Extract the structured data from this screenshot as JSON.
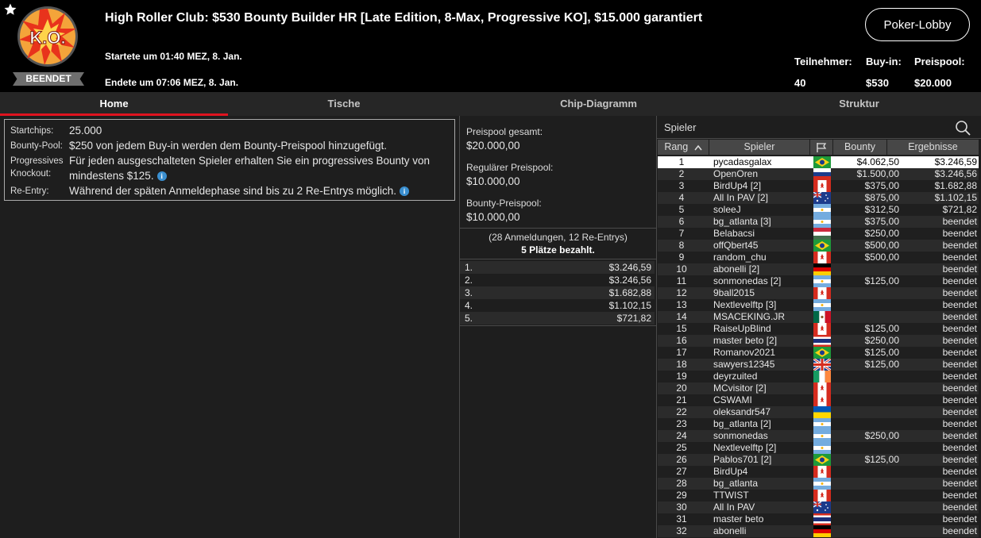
{
  "header": {
    "title": "High Roller Club: $530 Bounty Builder HR [Late Edition, 8-Max, Progressive KO], $15.000 garantiert",
    "logo_text": "K.O.",
    "status": "BEENDET",
    "started": "Startete um 01:40 MEZ, 8. Jan.",
    "ended": "Endete um 07:06 MEZ, 8. Jan.",
    "lobby_button": "Poker-Lobby",
    "stats": [
      {
        "label": "Teilnehmer:",
        "value": "40"
      },
      {
        "label": "Buy-in:",
        "value": "$530"
      },
      {
        "label": "Preispool:",
        "value": "$20.000"
      }
    ]
  },
  "tabs": [
    {
      "label": "Home",
      "active": true
    },
    {
      "label": "Tische",
      "active": false
    },
    {
      "label": "Chip-Diagramm",
      "active": false
    },
    {
      "label": "Struktur",
      "active": false
    }
  ],
  "info": {
    "startchips_label": "Startchips:",
    "startchips_value": "25.000",
    "bountypool_label": "Bounty-Pool:",
    "bountypool_value": "$250 von jedem Buy-in werden dem Bounty-Preispool hinzugefügt.",
    "pko_label_1": "Progressives",
    "pko_label_2": "Knockout:",
    "pko_value_1": "Für jeden ausgeschalteten Spieler erhalten Sie ein progressives Bounty von",
    "pko_value_2": "mindestens $125.",
    "reentry_label": "Re-Entry:",
    "reentry_value": "Während der späten Anmeldephase sind bis zu 2 Re-Entrys möglich.",
    "info_icon_glyph": "i"
  },
  "prizepool": {
    "total_label": "Preispool gesamt:",
    "total_value": "$20.000,00",
    "regular_label": "Regulärer Preispool:",
    "regular_value": "$10.000,00",
    "bounty_label": "Bounty-Preispool:",
    "bounty_value": "$10.000,00",
    "entries_text": "(28 Anmeldungen, 12 Re-Entrys)",
    "paid_text": "5 Plätze bezahlt.",
    "payouts": [
      {
        "pos": "1.",
        "amount": "$3.246,59"
      },
      {
        "pos": "2.",
        "amount": "$3.246,56"
      },
      {
        "pos": "3.",
        "amount": "$1.682,88"
      },
      {
        "pos": "4.",
        "amount": "$1.102,15"
      },
      {
        "pos": "5.",
        "amount": "$721,82"
      }
    ]
  },
  "players": {
    "search_label": "Spieler",
    "columns": {
      "rank": "Rang",
      "player": "Spieler",
      "bounty": "Bounty",
      "result": "Ergebnisse"
    },
    "rows": [
      {
        "rank": "1",
        "name": "pycadasgalax",
        "flag": "br",
        "bounty": "$4.062,50",
        "result": "$3.246,59"
      },
      {
        "rank": "2",
        "name": "OpenOren",
        "flag": "ru",
        "bounty": "$1.500,00",
        "result": "$3.246,56"
      },
      {
        "rank": "3",
        "name": "BirdUp4 [2]",
        "flag": "ca",
        "bounty": "$375,00",
        "result": "$1.682,88"
      },
      {
        "rank": "4",
        "name": "All In PAV [2]",
        "flag": "au",
        "bounty": "$875,00",
        "result": "$1.102,15"
      },
      {
        "rank": "5",
        "name": "soleeJ",
        "flag": "ar",
        "bounty": "$312,50",
        "result": "$721,82"
      },
      {
        "rank": "6",
        "name": "bg_atlanta [3]",
        "flag": "ar",
        "bounty": "$375,00",
        "result": "beendet"
      },
      {
        "rank": "7",
        "name": "Belabacsi",
        "flag": "hu",
        "bounty": "$250,00",
        "result": "beendet"
      },
      {
        "rank": "8",
        "name": "offQbert45",
        "flag": "br",
        "bounty": "$500,00",
        "result": "beendet"
      },
      {
        "rank": "9",
        "name": "random_chu",
        "flag": "ca",
        "bounty": "$500,00",
        "result": "beendet"
      },
      {
        "rank": "10",
        "name": "abonelli [2]",
        "flag": "de",
        "bounty": "",
        "result": "beendet"
      },
      {
        "rank": "11",
        "name": "sonmonedas [2]",
        "flag": "ar",
        "bounty": "$125,00",
        "result": "beendet"
      },
      {
        "rank": "12",
        "name": "9ball2015",
        "flag": "ca",
        "bounty": "",
        "result": "beendet"
      },
      {
        "rank": "13",
        "name": "Nextlevelftp [3]",
        "flag": "ar",
        "bounty": "",
        "result": "beendet"
      },
      {
        "rank": "14",
        "name": "MSACEKING.JR",
        "flag": "mx",
        "bounty": "",
        "result": "beendet"
      },
      {
        "rank": "15",
        "name": "RaiseUpBlind",
        "flag": "ca",
        "bounty": "$125,00",
        "result": "beendet"
      },
      {
        "rank": "16",
        "name": "master beto [2]",
        "flag": "th",
        "bounty": "$250,00",
        "result": "beendet"
      },
      {
        "rank": "17",
        "name": "Romanov2021",
        "flag": "br",
        "bounty": "$125,00",
        "result": "beendet"
      },
      {
        "rank": "18",
        "name": "sawyers12345",
        "flag": "gb",
        "bounty": "$125,00",
        "result": "beendet"
      },
      {
        "rank": "19",
        "name": "deyrzuited",
        "flag": "ie",
        "bounty": "",
        "result": "beendet"
      },
      {
        "rank": "20",
        "name": "MCvisitor [2]",
        "flag": "ca",
        "bounty": "",
        "result": "beendet"
      },
      {
        "rank": "21",
        "name": "CSWAMI",
        "flag": "ca",
        "bounty": "",
        "result": "beendet"
      },
      {
        "rank": "22",
        "name": "oleksandr547",
        "flag": "ua",
        "bounty": "",
        "result": "beendet"
      },
      {
        "rank": "23",
        "name": "bg_atlanta [2]",
        "flag": "ar",
        "bounty": "",
        "result": "beendet"
      },
      {
        "rank": "24",
        "name": "sonmonedas",
        "flag": "ar",
        "bounty": "$250,00",
        "result": "beendet"
      },
      {
        "rank": "25",
        "name": "Nextlevelftp [2]",
        "flag": "ar",
        "bounty": "",
        "result": "beendet"
      },
      {
        "rank": "26",
        "name": "Pablos701 [2]",
        "flag": "br",
        "bounty": "$125,00",
        "result": "beendet"
      },
      {
        "rank": "27",
        "name": "BirdUp4",
        "flag": "ca",
        "bounty": "",
        "result": "beendet"
      },
      {
        "rank": "28",
        "name": "bg_atlanta",
        "flag": "ar",
        "bounty": "",
        "result": "beendet"
      },
      {
        "rank": "29",
        "name": "TTWIST",
        "flag": "ca",
        "bounty": "",
        "result": "beendet"
      },
      {
        "rank": "30",
        "name": "All In PAV",
        "flag": "au",
        "bounty": "",
        "result": "beendet"
      },
      {
        "rank": "31",
        "name": "master beto",
        "flag": "th",
        "bounty": "",
        "result": "beendet"
      },
      {
        "rank": "32",
        "name": "abonelli",
        "flag": "de",
        "bounty": "",
        "result": "beendet"
      }
    ]
  },
  "colors": {
    "accent": "#e0131f",
    "header_bg": "#000000",
    "page_bg": "#1e1e1e",
    "row_dark": "#2b2b2b",
    "row_light": "#1f1f1f",
    "selected_row": "#ffffff"
  },
  "icons": [
    "star-icon",
    "ko-logo-icon",
    "info-icon",
    "search-icon",
    "flag-icon",
    "sort-asc-icon"
  ]
}
